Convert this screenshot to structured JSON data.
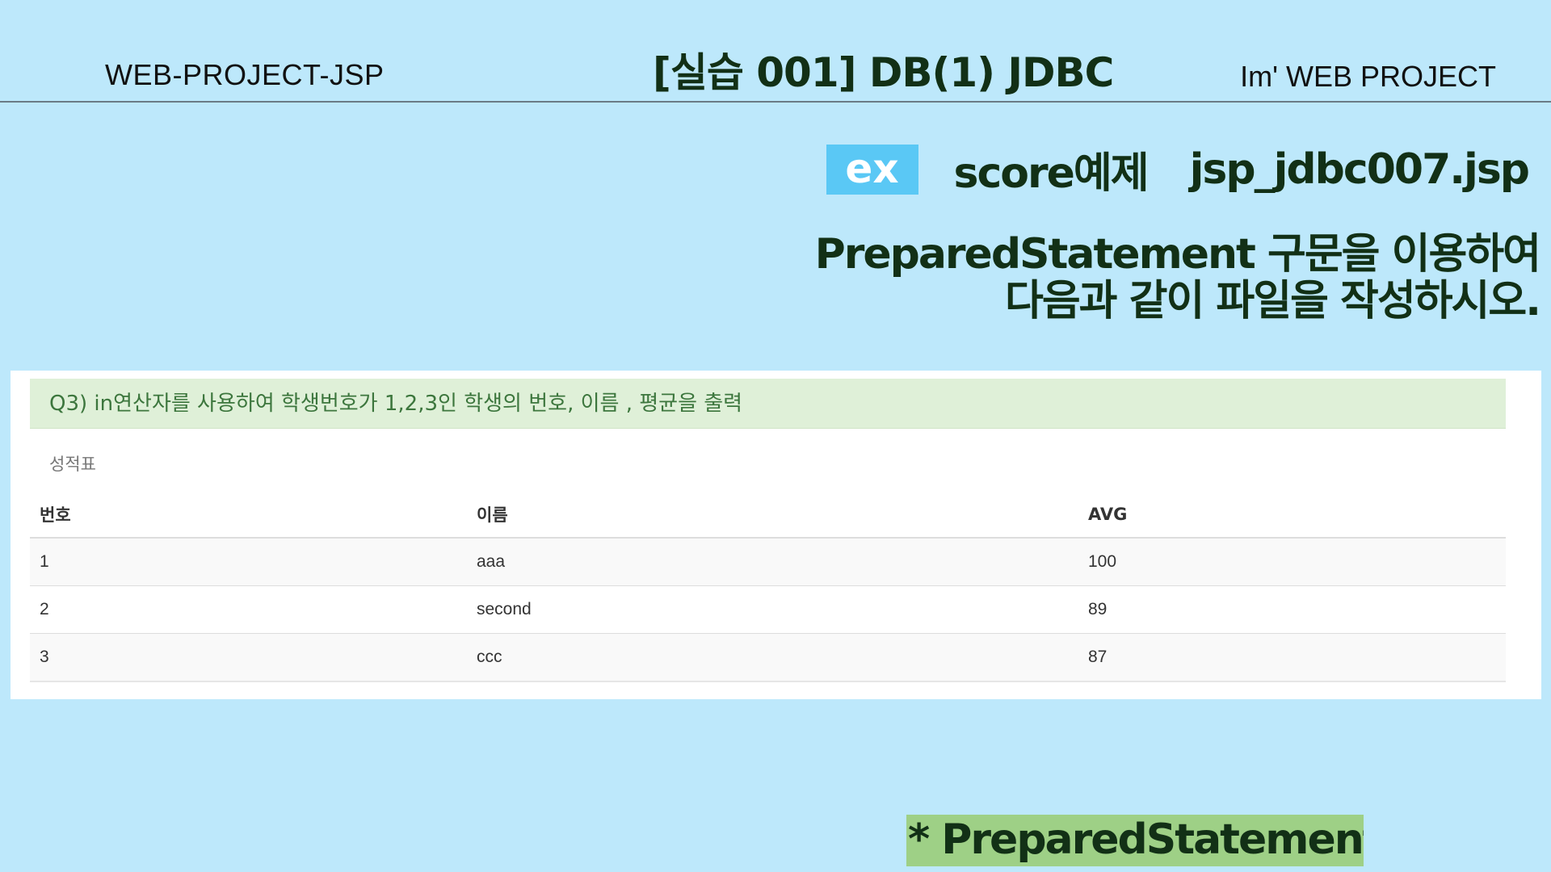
{
  "header": {
    "left": "WEB-PROJECT-JSP",
    "center": "[실습 001]  DB(1) JDBC",
    "right": "Im'  WEB PROJECT"
  },
  "example": {
    "badge": "ex",
    "title": "score예제",
    "file": "jsp_jdbc007.jsp"
  },
  "instruction": {
    "line1": "PreparedStatement 구문을 이용하여",
    "line2": "다음과 같이 파일을 작성하시오."
  },
  "panel": {
    "alert": "Q3) in연산자를 사용하여 학생번호가 1,2,3인 학생의 번호, 이름 , 평균을 출력",
    "caption": "성적표",
    "columns": [
      "번호",
      "이름",
      "AVG"
    ],
    "rows": [
      [
        "1",
        "aaa",
        "100"
      ],
      [
        "2",
        "second",
        "89"
      ],
      [
        "3",
        "ccc",
        "87"
      ]
    ]
  },
  "footer": {
    "tag": "* PreparedStatement"
  },
  "colors": {
    "background": "#bde8fb",
    "badge": "#5ac8f5",
    "dark_green": "#123016",
    "alert_bg": "#dff0d8",
    "alert_text": "#3c763d",
    "footer_tag_bg": "#9ed086"
  }
}
